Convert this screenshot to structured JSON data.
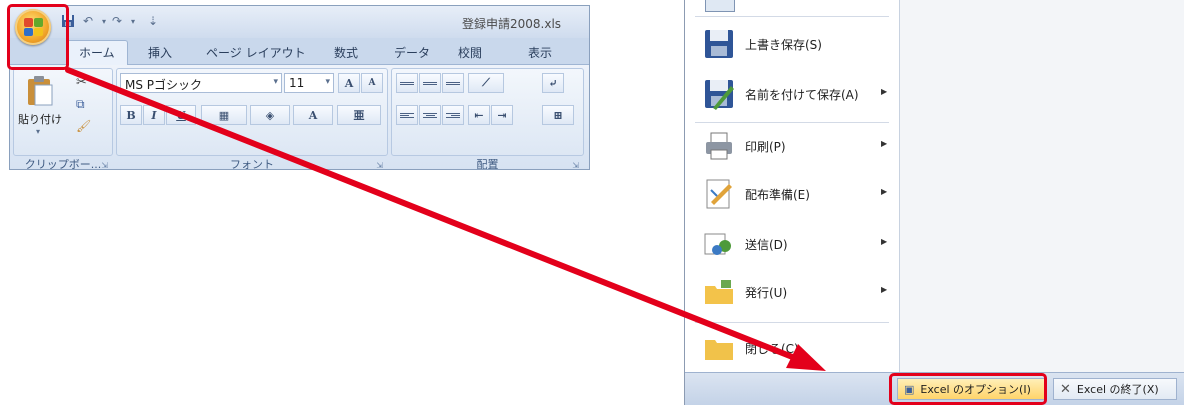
{
  "window": {
    "title": "登録申請2008.xls"
  },
  "ribbon": {
    "tabs": [
      "ホーム",
      "挿入",
      "ページ レイアウト",
      "数式",
      "データ",
      "校閲",
      "表示"
    ],
    "paste_label": "貼り付け",
    "font_name": "MS Pゴシック",
    "font_size": "11",
    "groups": {
      "clipboard": "クリップボー...",
      "font": "フォント",
      "alignment": "配置"
    }
  },
  "office_menu": {
    "items": [
      {
        "label": "上書き保存(S)",
        "icon": "save-icon",
        "submenu": false
      },
      {
        "label": "名前を付けて保存(A)",
        "icon": "save-as-icon",
        "submenu": true
      },
      {
        "label": "印刷(P)",
        "icon": "print-icon",
        "submenu": true
      },
      {
        "label": "配布準備(E)",
        "icon": "prepare-icon",
        "submenu": true
      },
      {
        "label": "送信(D)",
        "icon": "send-icon",
        "submenu": true
      },
      {
        "label": "発行(U)",
        "icon": "publish-icon",
        "submenu": true
      },
      {
        "label": "閉じる(C)",
        "icon": "close-folder-icon",
        "submenu": false
      }
    ],
    "options_button": "Excel のオプション(I)",
    "exit_button": "Excel の終了(X)"
  },
  "colors": {
    "highlight": "#e3001b",
    "ribbon_bg": "#dbe6f4",
    "office_button": "#f2a62a"
  }
}
